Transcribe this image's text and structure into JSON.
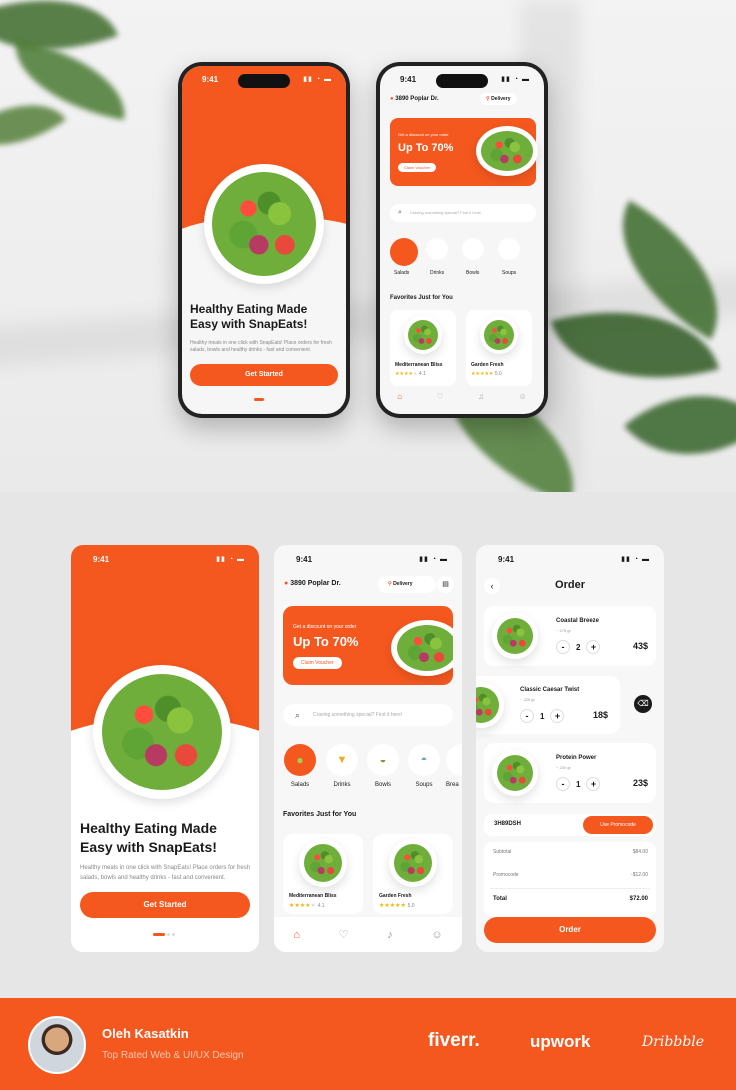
{
  "onboarding": {
    "time": "9:41",
    "headline_1": "Healthy Eating Made",
    "headline_2": "Easy with SnapEats!",
    "body": "Healthy meals in one click with SnapEats! Place orders for fresh salads, bowls and healthy drinks - fast and convenient.",
    "cta": "Get Started"
  },
  "home": {
    "time": "9:41",
    "address": "3890 Poplar Dr.",
    "delivery": "Delivery",
    "promo_small": "Get a discount on your order",
    "promo_big": "Up To 70%",
    "promo_btn": "Claim Voucher",
    "search_placeholder": "Craving something special? Find it here!",
    "categories": [
      {
        "label": "Salads"
      },
      {
        "label": "Drinks"
      },
      {
        "label": "Bowls"
      },
      {
        "label": "Soups"
      },
      {
        "label": "Brea"
      }
    ],
    "section": "Favorites Just for You",
    "favorites": [
      {
        "name": "Mediterranean Bliss",
        "rating": "4.1"
      },
      {
        "name": "Garden Fresh",
        "rating": "5.0"
      }
    ]
  },
  "order": {
    "time": "9:41",
    "title": "Order",
    "items": [
      {
        "name": "Coastal Breeze",
        "weight": "~ 275 gr",
        "qty": "2",
        "price": "43$"
      },
      {
        "name": "Classic Caesar Twist",
        "weight": "~ 225 gr",
        "qty": "1",
        "price": "18$"
      },
      {
        "name": "Protein Power",
        "weight": "~ 240 gr",
        "qty": "1",
        "price": "23$"
      }
    ],
    "promocode": "3H89DSH",
    "promo_btn": "Use Promocode",
    "subtotal_label": "Subtotal",
    "subtotal": "$84.00",
    "promocode_label": "Promocode",
    "promocode_value": "-$12.00",
    "total_label": "Total",
    "total": "$72.00",
    "cta": "Order"
  },
  "footer": {
    "name": "Oleh Kasatkin",
    "subtitle": "Top Rated Web & UI/UX Design",
    "logo_1": "fiverr.",
    "logo_2": "upwork",
    "logo_3": "Dribbble"
  },
  "colors": {
    "accent": "#f4581f",
    "star": "#f5b400"
  }
}
